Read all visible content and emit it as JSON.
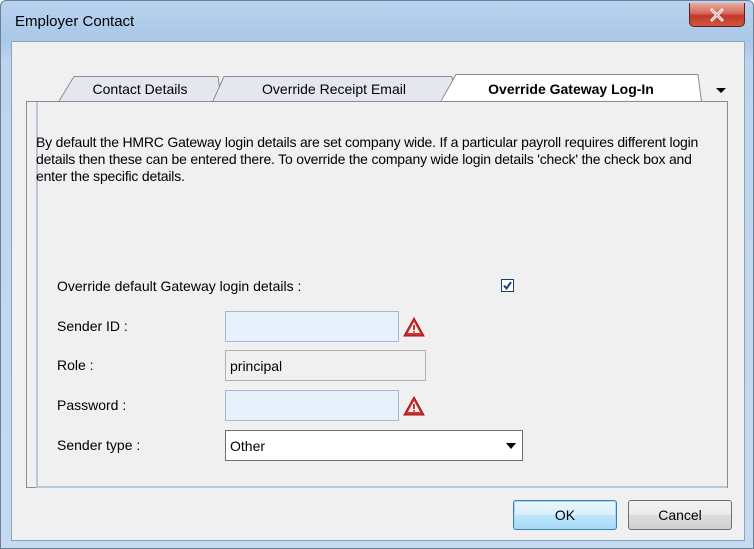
{
  "window": {
    "title": "Employer Contact"
  },
  "tabs": [
    {
      "label": "Contact Details",
      "active": false
    },
    {
      "label": "Override Receipt Email",
      "active": false
    },
    {
      "label": "Override Gateway Log-In",
      "active": true
    }
  ],
  "panel": {
    "description": "By default the HMRC Gateway login details are set company wide. If a particular payroll requires different login details then these can be entered there. To override the company wide login details 'check' the check box and enter the specific details.",
    "override_label": "Override default Gateway login details :",
    "override_checked": true,
    "sender_id": {
      "label": "Sender ID :",
      "value": "",
      "warning": true
    },
    "role": {
      "label": "Role :",
      "value": "principal"
    },
    "password": {
      "label": "Password :",
      "value": "",
      "warning": true
    },
    "sender_type": {
      "label": "Sender type :",
      "value": "Other"
    }
  },
  "buttons": {
    "ok": "OK",
    "cancel": "Cancel"
  },
  "icons": {
    "close": "close-icon",
    "warning": "warning-triangle-icon",
    "check": "check-icon",
    "overflow": "chevron-down-icon"
  },
  "colors": {
    "accent": "#a9c7e8",
    "warning": "#d32f2f",
    "close": "#c0392b"
  }
}
